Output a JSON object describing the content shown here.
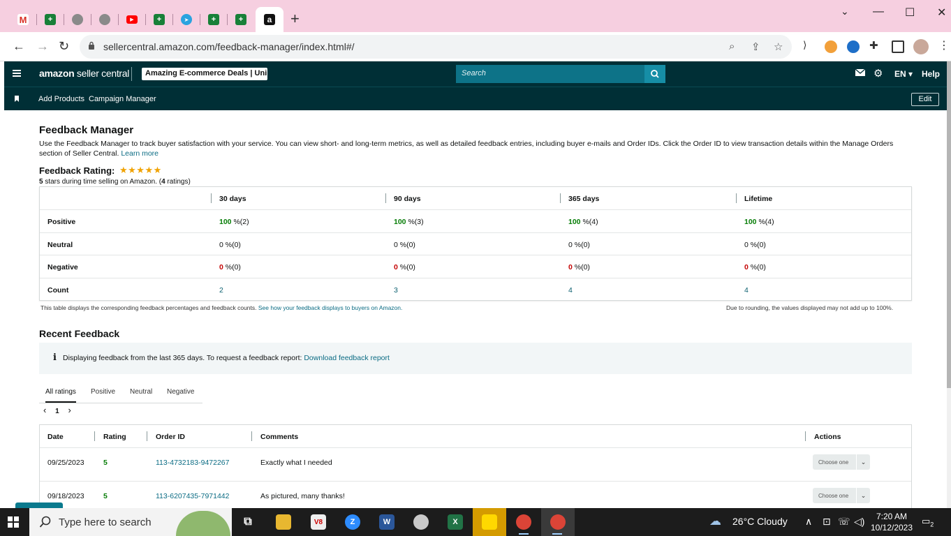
{
  "browser": {
    "url": "sellercentral.amazon.com/feedback-manager/index.html#/",
    "new_tab": "+",
    "window_controls": {
      "minimize": "—",
      "maximize": "☐",
      "close": "✕",
      "tab_search": "⌄"
    },
    "tab_favicons": [
      "gmail-icon",
      "sheets-icon",
      "globe-icon",
      "globe-icon",
      "youtube-icon",
      "sheets-icon",
      "telegram-icon",
      "sheets-icon",
      "sheets-icon",
      "amazon-icon"
    ]
  },
  "header": {
    "logo_bold": "amazon",
    "logo_light": " seller central",
    "store_name": "Amazing E-commerce Deals | Uni...",
    "search_placeholder": "Search",
    "language": "EN ▾",
    "help": "Help"
  },
  "nav": {
    "links": [
      "Add Products",
      "Campaign Manager"
    ],
    "edit": "Edit"
  },
  "page": {
    "title": "Feedback Manager",
    "intro": "Use the Feedback Manager to track buyer satisfaction with your service. You can view short- and long-term metrics, as well as detailed feedback entries, including buyer e-mails and Order IDs. Click the Order ID to view transaction details within the Manage Orders section of Seller Central.",
    "learn_more": "Learn more",
    "rating_label": "Feedback Rating:",
    "stars": "★★★★★",
    "rating_value": "5",
    "rating_mid": " stars during time selling on Amazon. (",
    "rating_count": "4",
    "rating_end": " ratings)"
  },
  "feedback_table": {
    "columns": [
      "30 days",
      "90 days",
      "365 days",
      "Lifetime"
    ],
    "rows": [
      {
        "label": "Positive",
        "type": "pos",
        "cells": [
          {
            "v": "100",
            "c": " %(2)"
          },
          {
            "v": "100",
            "c": " %(3)"
          },
          {
            "v": "100",
            "c": " %(4)"
          },
          {
            "v": "100",
            "c": " %(4)"
          }
        ]
      },
      {
        "label": "Neutral",
        "type": "neu",
        "cells": [
          {
            "v": "0",
            "c": " %(0)"
          },
          {
            "v": "0",
            "c": " %(0)"
          },
          {
            "v": "0",
            "c": " %(0)"
          },
          {
            "v": "0",
            "c": " %(0)"
          }
        ]
      },
      {
        "label": "Negative",
        "type": "neg",
        "cells": [
          {
            "v": "0",
            "c": " %(0)"
          },
          {
            "v": "0",
            "c": " %(0)"
          },
          {
            "v": "0",
            "c": " %(0)"
          },
          {
            "v": "0",
            "c": " %(0)"
          }
        ]
      },
      {
        "label": "Count",
        "type": "cnt",
        "cells": [
          {
            "v": "2",
            "c": ""
          },
          {
            "v": "3",
            "c": ""
          },
          {
            "v": "4",
            "c": ""
          },
          {
            "v": "4",
            "c": ""
          }
        ]
      }
    ],
    "footnote_left": "This table displays the corresponding feedback percentages and feedback counts.",
    "footnote_link": "See how your feedback displays to buyers on Amazon.",
    "footnote_right": "Due to rounding, the values displayed may not add up to 100%."
  },
  "recent": {
    "title": "Recent Feedback",
    "info_icon": "i",
    "info_text": "Displaying feedback from the last 365 days. To request a feedback report:",
    "info_link": "Download feedback report",
    "tabs": [
      "All ratings",
      "Positive",
      "Neutral",
      "Negative"
    ],
    "pager": {
      "prev": "‹",
      "page": "1",
      "next": "›"
    },
    "columns": [
      "Date",
      "Rating",
      "Order ID",
      "Comments",
      "Actions"
    ],
    "rows": [
      {
        "date": "09/25/2023",
        "rating": "5",
        "order_id": "113-4732183-9472267",
        "comment": "Exactly what I needed",
        "action": "Choose one"
      },
      {
        "date": "09/18/2023",
        "rating": "5",
        "order_id": "113-6207435-7971442",
        "comment": "As pictured, many thanks!",
        "action": "Choose one"
      }
    ]
  },
  "taskbar": {
    "search_placeholder": "Type here to search",
    "weather": "26°C  Cloudy",
    "time": "7:20 AM",
    "date": "10/12/2023",
    "notifications": "2"
  },
  "colors": {
    "tabstrip": "#f6cfe0",
    "sc_header": "#002f36",
    "search_bg": "#0d7388",
    "positive": "#067d06",
    "negative": "#c40000",
    "link": "#0a6b83"
  }
}
